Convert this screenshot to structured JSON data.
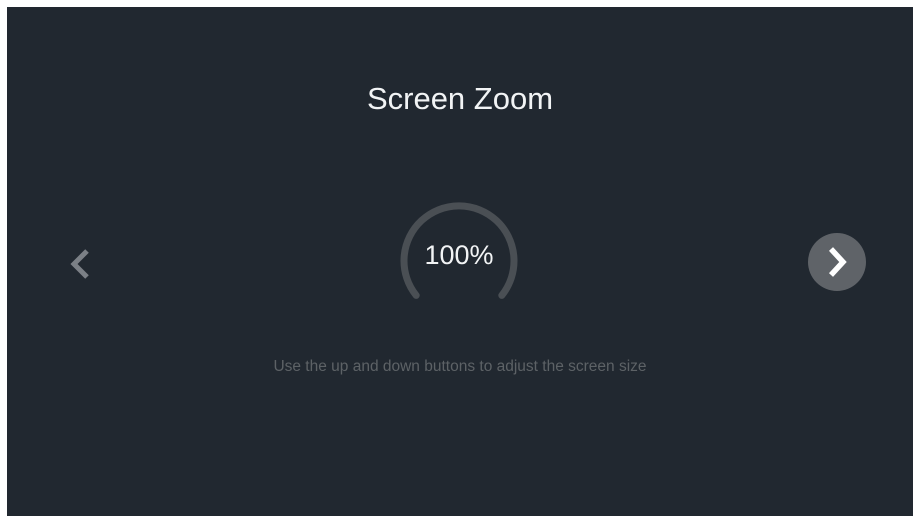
{
  "screen": {
    "title": "Screen Zoom",
    "hint": "Use the up and down buttons to adjust the screen size",
    "background_color": "#212830"
  },
  "zoom": {
    "value_label": "100%",
    "gauge_track_color": "#4a4f54"
  },
  "navigation": {
    "prev_icon": "chevron-left-icon",
    "next_icon": "chevron-right-icon",
    "next_button_color": "#5f6368"
  }
}
